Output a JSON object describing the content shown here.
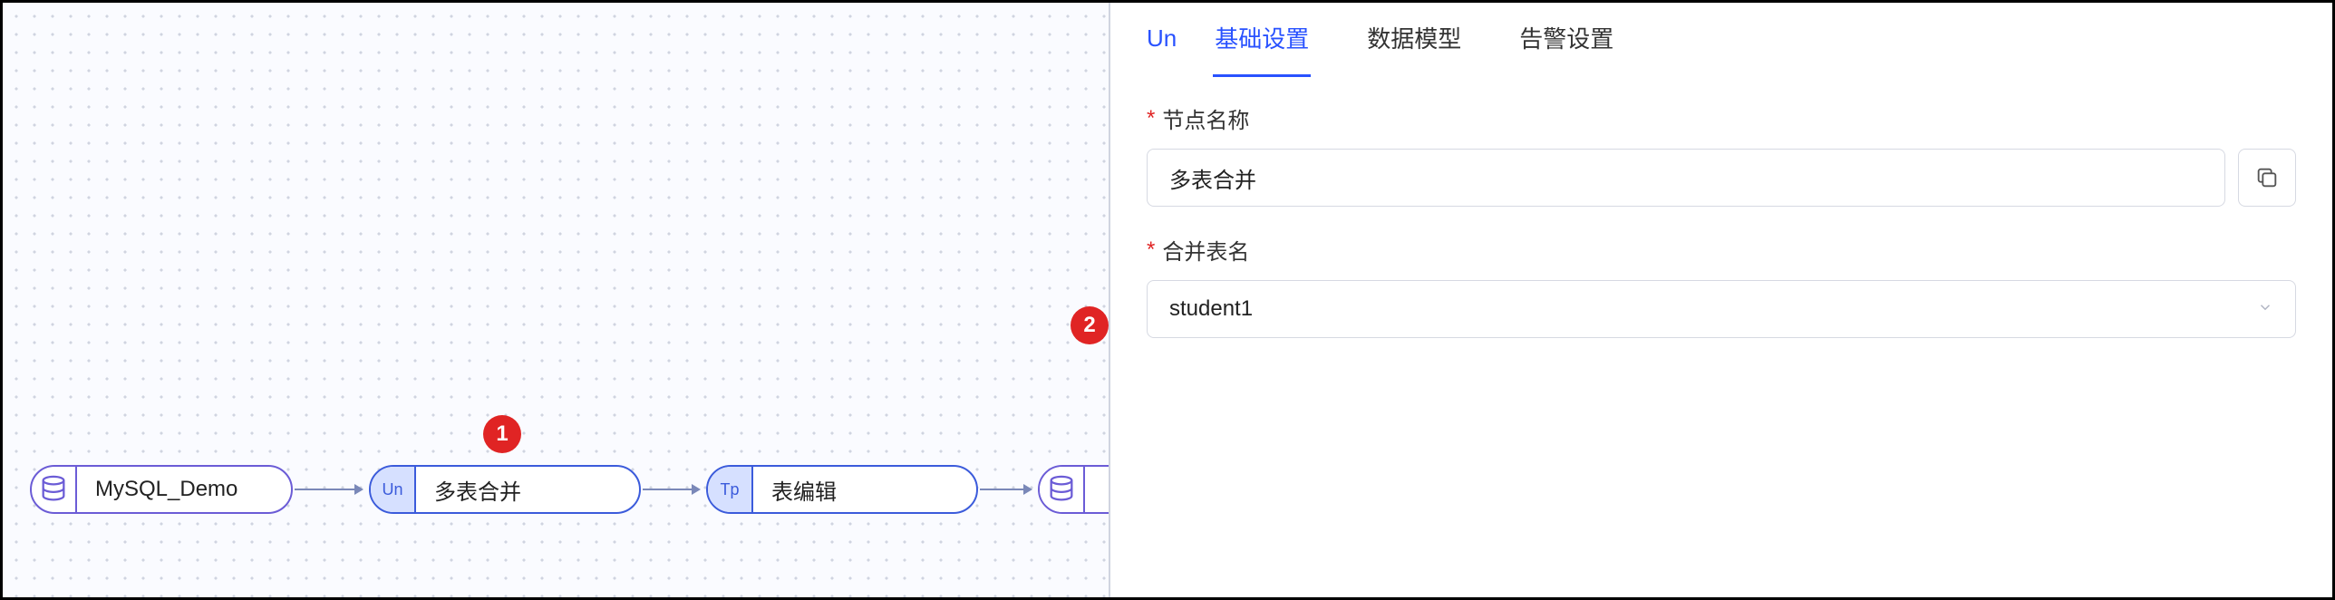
{
  "canvas": {
    "nodes": {
      "source": {
        "label": "MySQL_Demo",
        "icon": "database-icon"
      },
      "merge": {
        "label": "多表合并",
        "tag": "Un"
      },
      "edit": {
        "label": "表编辑",
        "tag": "Tp"
      },
      "target": {
        "label": "",
        "icon": "database-icon"
      }
    },
    "badges": {
      "b1": "1",
      "b2": "2"
    }
  },
  "panel": {
    "tabs": {
      "prefix": "Un",
      "items": [
        {
          "label": "基础设置",
          "active": true
        },
        {
          "label": "数据模型",
          "active": false
        },
        {
          "label": "告警设置",
          "active": false
        }
      ]
    },
    "form": {
      "nodeName": {
        "label": "节点名称",
        "value": "多表合并"
      },
      "mergeTable": {
        "label": "合并表名",
        "value": "student1"
      }
    }
  },
  "colors": {
    "accent": "#2952ff",
    "danger": "#e02424",
    "nodeBlue": "#3b5bdb",
    "nodePurple": "#6b5cd6"
  }
}
